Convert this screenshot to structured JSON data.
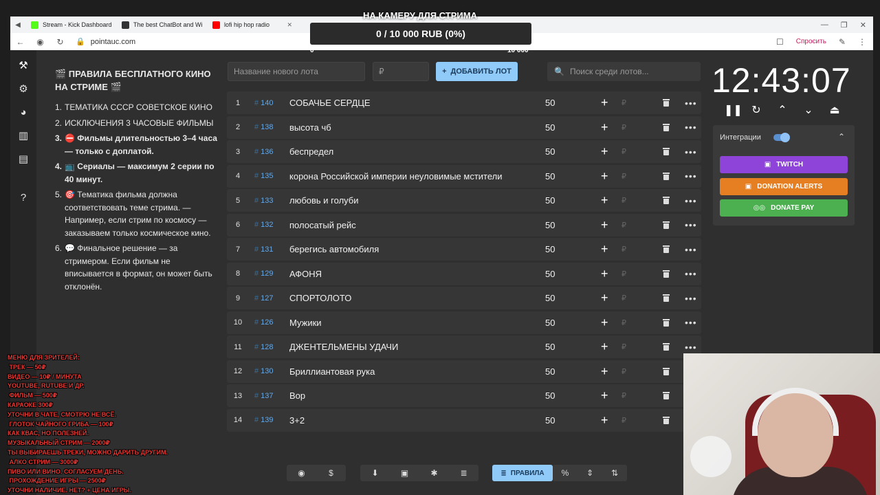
{
  "browser": {
    "tabs": [
      {
        "title": "Stream - Kick Dashboard",
        "color": "#53fc18"
      },
      {
        "title": "The best ChatBot and Wi",
        "color": "#333333"
      },
      {
        "title": "lofi hip hop radio",
        "color": "#ff0000"
      }
    ],
    "url": "pointauc.com",
    "ask_label": "Спросить"
  },
  "goal": {
    "title": "НА КАМЕРУ ДЛЯ СТРИМА",
    "progress": "0 / 10 000 RUB (0%)",
    "min": "0",
    "max": "10 000",
    "fraction": 0
  },
  "rules": {
    "title": "🎬 ПРАВИЛА БЕСПЛАТНОГО КИНО НА СТРИМЕ 🎬",
    "items": [
      {
        "n": "1.",
        "text": "ТЕМАТИКА СССР СОВЕТСКОЕ КИНО"
      },
      {
        "n": "2.",
        "text": "ИСКЛЮЧЕНИЯ  3 ЧАСОВЫЕ ФИЛЬМЫ"
      },
      {
        "n": "3.",
        "text": "⛔ Фильмы длительностью 3–4 часа — только с доплатой."
      },
      {
        "n": "4.",
        "text": "📺 Сериалы — максимум 2 серии по 40 минут."
      },
      {
        "n": "5.",
        "text": "🎯 Тематика фильма должна соответствовать теме стрима. — Например, если стрим по космосу — заказываем только космическое кино."
      },
      {
        "n": "6.",
        "text": "💬 Финальное решение — за стримером. Если фильм не вписывается в формат, он может быть отклонён."
      }
    ]
  },
  "toolbar": {
    "new_lot_placeholder": "Название нового лота",
    "amount_placeholder": "₽",
    "add_label": "ДОБАВИТЬ ЛОТ",
    "search_placeholder": "Поиск среди лотов..."
  },
  "lots": [
    {
      "idx": "1",
      "id": "140",
      "name": "СОБАЧЬЕ СЕРДЦЕ",
      "amount": "50"
    },
    {
      "idx": "2",
      "id": "138",
      "name": "высота чб",
      "amount": "50"
    },
    {
      "idx": "3",
      "id": "136",
      "name": "беспредел",
      "amount": "50"
    },
    {
      "idx": "4",
      "id": "135",
      "name": "корона Российской империи неуловимые мстители",
      "amount": "50"
    },
    {
      "idx": "5",
      "id": "133",
      "name": "любовь и голуби",
      "amount": "50"
    },
    {
      "idx": "6",
      "id": "132",
      "name": "полосатый рейс",
      "amount": "50"
    },
    {
      "idx": "7",
      "id": "131",
      "name": "берегись автомобиля",
      "amount": "50"
    },
    {
      "idx": "8",
      "id": "129",
      "name": "АФОНЯ",
      "amount": "50"
    },
    {
      "idx": "9",
      "id": "127",
      "name": "СПОРТОЛОТО",
      "amount": "50"
    },
    {
      "idx": "10",
      "id": "126",
      "name": " Мужики",
      "amount": "50"
    },
    {
      "idx": "11",
      "id": "128",
      "name": "ДЖЕНТЕЛЬМЕНЫ УДАЧИ",
      "amount": "50"
    },
    {
      "idx": "12",
      "id": "130",
      "name": "Бриллиантовая рука",
      "amount": "50"
    },
    {
      "idx": "13",
      "id": "137",
      "name": "Вор",
      "amount": "50"
    },
    {
      "idx": "14",
      "id": "139",
      "name": "3+2",
      "amount": "50"
    }
  ],
  "currency": "₽",
  "timer": "12:43:07",
  "integrations": {
    "label": "Интеграции",
    "enabled": true,
    "twitch": "TWITCH",
    "donation_alerts": "DONATION ALERTS",
    "donate_pay": "DONATE PAY"
  },
  "bottom": {
    "rules_label": "ПРАВИЛА"
  },
  "overlay_lines": [
    "МЕНЮ ДЛЯ ЗРИТЕЛЕЙ:",
    " ТРЕК — 50₽",
    "ВИДЕО — 10₽ / МИНУТА",
    "YOUTUBE, RUTUBE И ДР.",
    " ФИЛЬМ — 500₽",
    "КАРАОКЕ 300₽",
    "УТОЧНИ В ЧАТЕ, СМОТРЮ НЕ ВСЁ.",
    " ГЛОТОК ЧАЙНОГО ГРИБА — 100₽",
    "КАК КВАС, НО ПОЛЕЗНЕЙ.",
    "МУЗЫКАЛЬНЫЙ СТРИМ — 2000₽",
    "ТЫ ВЫБИРАЕШЬ ТРЕКИ, МОЖНО ДАРИТЬ ДРУГИМ.",
    " АЛКО СТРИМ — 3000₽",
    "ПИВО ИЛИ ВИНО. СОГЛАСУЕМ ДЕНЬ.",
    " ПРОХОЖДЕНИЕ ИГРЫ — 2500₽",
    "УТОЧНИ НАЛИЧИЕ. НЕТ? + ЦЕНА ИГРЫ."
  ]
}
